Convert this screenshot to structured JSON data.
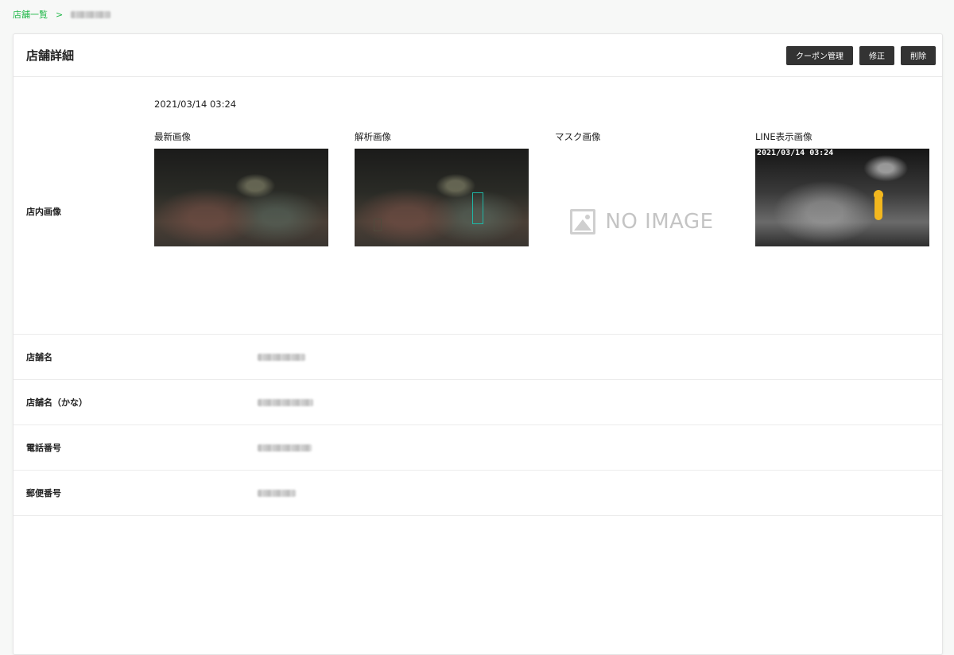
{
  "breadcrumb": {
    "root_label": "店舗一覧",
    "separator": ">",
    "current": "(blurred)"
  },
  "header": {
    "title": "店舗詳細",
    "buttons": {
      "coupon": "クーポン管理",
      "edit": "修正",
      "delete": "削除"
    }
  },
  "images_section": {
    "label": "店内画像",
    "datetime": "2021/03/14 03:24",
    "columns": [
      {
        "label": "最新画像",
        "kind": "photo"
      },
      {
        "label": "解析画像",
        "kind": "analysis"
      },
      {
        "label": "マスク画像",
        "kind": "noimage",
        "placeholder": "NO IMAGE"
      },
      {
        "label": "LINE表示画像",
        "kind": "line",
        "overlay_text": "2021/03/14  03:24"
      }
    ]
  },
  "fields": [
    {
      "label": "店舗名",
      "value": "(blurred)"
    },
    {
      "label": "店舗名（かな）",
      "value": "(blurred)"
    },
    {
      "label": "電話番号",
      "value": "(blurred)"
    },
    {
      "label": "郵便番号",
      "value": "(blurred)"
    }
  ],
  "colors": {
    "accent_green": "#22b84a",
    "button_dark": "#333333",
    "detection_box": "#1fb7a6",
    "person_marker": "#f3b71e"
  },
  "icons": {
    "noimage": "image-placeholder-icon"
  }
}
